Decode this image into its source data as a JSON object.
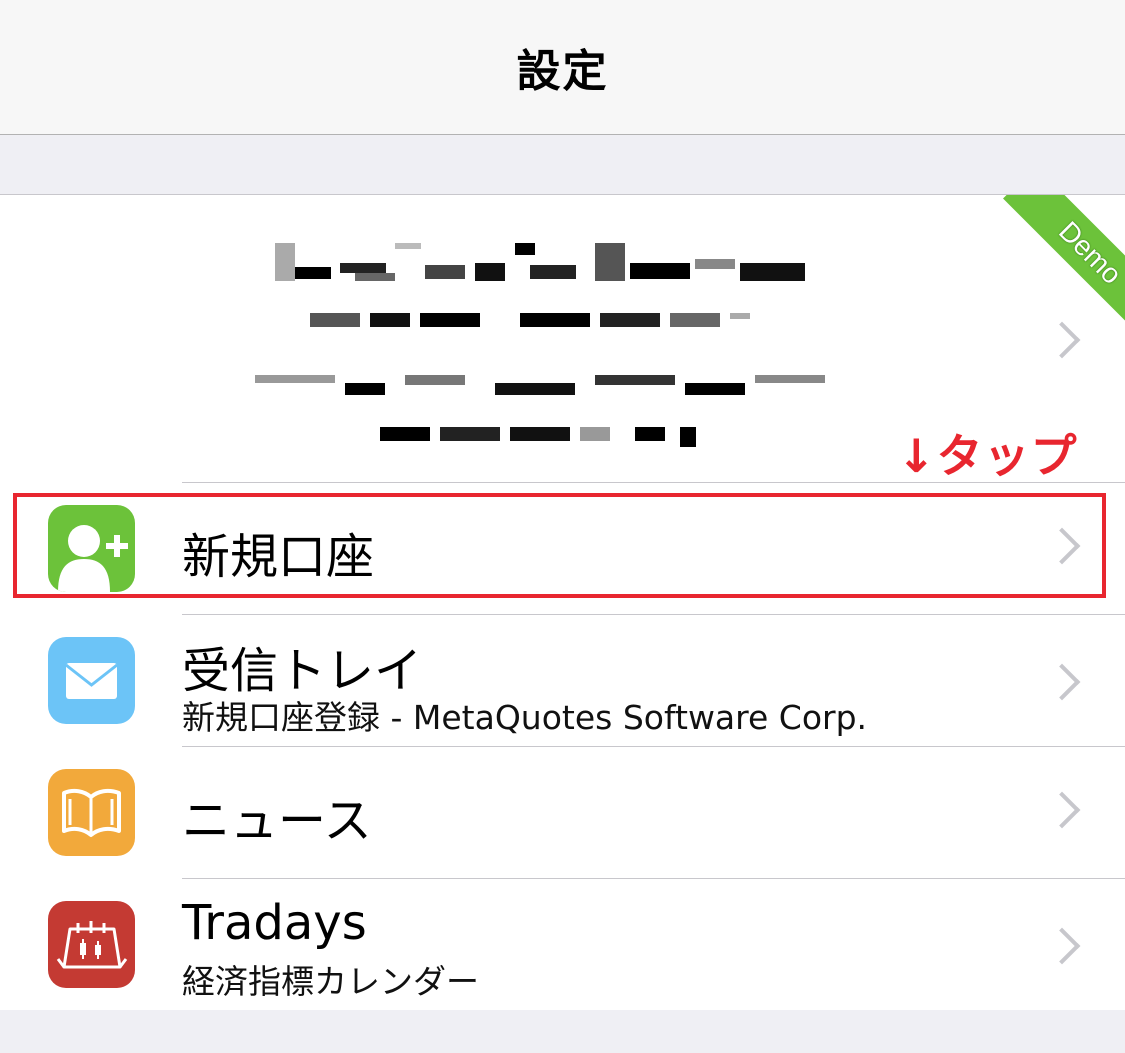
{
  "navbar": {
    "title": "設定"
  },
  "account": {
    "badge": "Demo",
    "badge_color": "#6cc23a",
    "details_redacted": true
  },
  "annotation": {
    "tap_hint": "↓タップ",
    "color": "#e8262f"
  },
  "menu": {
    "items": [
      {
        "title": "新規口座",
        "subtitle": "",
        "icon": "add-user-icon",
        "icon_color": "#6cc23a"
      },
      {
        "title": "受信トレイ",
        "subtitle": "新規口座登録 - MetaQuotes Software Corp.",
        "icon": "envelope-icon",
        "icon_color": "#6cc4f7"
      },
      {
        "title": "ニュース",
        "subtitle": "",
        "icon": "book-icon",
        "icon_color": "#f2a93b"
      },
      {
        "title": "Tradays",
        "subtitle": "経済指標カレンダー",
        "icon": "calendar-icon",
        "icon_color": "#c43a33"
      }
    ]
  }
}
